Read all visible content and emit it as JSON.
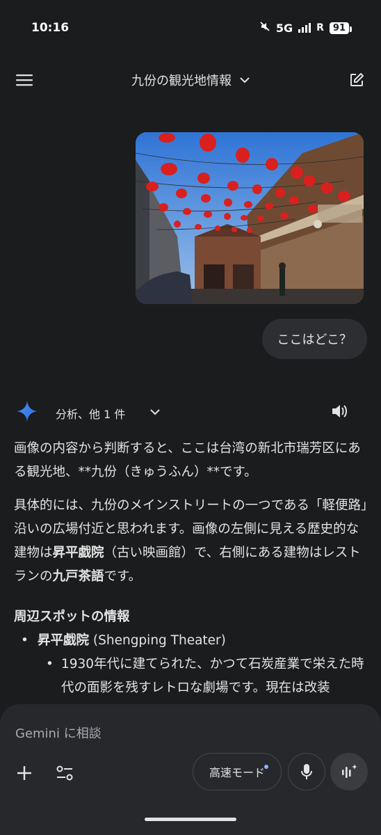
{
  "status": {
    "time": "10:16",
    "network": "5G",
    "carrier_suffix": "R",
    "battery": "91"
  },
  "header": {
    "title": "九份の観光地情報"
  },
  "user_message": "ここはどこ？",
  "response": {
    "header_label": "分析、他 1 件",
    "para1": "画像の内容から判断すると、ここは台湾の新北市瑞芳区にある観光地、**九份（きゅうふん）**です。",
    "para2_a": "具体的には、九份のメインストリートの一つである「軽便路」沿いの広場付近と思われます。画像の左側に見える歴史的な建物は",
    "para2_b": "昇平戯院",
    "para2_c": "（古い映画館）で、右側にある建物はレストランの",
    "para2_d": "九戸茶語",
    "para2_e": "です。",
    "section_title": "周辺スポットの情報",
    "bullet1_bold": "昇平戯院",
    "bullet1_rest": " (Shengping Theater)",
    "bullet2": "1930年代に建てられた、かつて石炭産業で栄えた時代の面影を残すレトロな劇場です。現在は改装"
  },
  "composer": {
    "placeholder": "Gemini に相談",
    "mode_label": "高速モード"
  },
  "colors": {
    "background": "#1b1c1e",
    "composer": "#26282b",
    "bubble": "#2c2e31",
    "accent": "#4285f4"
  }
}
